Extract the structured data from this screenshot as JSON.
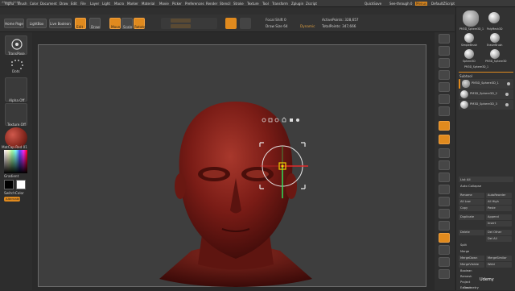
{
  "app": {
    "title": "ZBrush 2018",
    "menus": [
      "Alpha",
      "Brush",
      "Color",
      "Document",
      "Draw",
      "Edit",
      "File",
      "Layer",
      "Light",
      "Macro",
      "Marker",
      "Material",
      "Movie",
      "Picker",
      "Preferences",
      "Render",
      "Stencil",
      "Stroke",
      "Texture",
      "Tool",
      "Transform",
      "Zplugin",
      "Zscript"
    ],
    "right_menus": [
      "QuickSave",
      "See-through 0",
      "Menus",
      "DefaultZScript"
    ]
  },
  "toolbar": {
    "home_page": "Home Page",
    "lightbox": "LightBox",
    "live_boolean": "Live Boolean",
    "edit": "Edit",
    "draw": "Draw",
    "move": "Move",
    "scale": "Scale",
    "rotate": "Rotate",
    "focal_shift": "Focal Shift 0",
    "draw_size": "Draw Size 64",
    "dynamic": "Dynamic",
    "active_points": "ActivePoints: 328,657",
    "total_points": "TotalPoints: 347,666"
  },
  "left_panel": {
    "brush_label": "TransPose",
    "dots_label": "Dots",
    "alpha_label": "Alpha Off",
    "texture_label": "Texture Off",
    "material_label": "MatCap Red 01",
    "gradient_label": "Gradient",
    "switch_color": "SwitchColor",
    "alternate": "Alternate"
  },
  "right_panel": {
    "tools": [
      "PM3D_Sphere3D_1",
      "PolyMesh3D",
      "SimpleBrush",
      "EraserBrush",
      "Sphere3D",
      "PM3D_Sphere3D",
      "PM3D_Sphere3D_1"
    ],
    "subtool_header": "Subtool",
    "subtools": [
      "PM3D_Sphere3D_1",
      "PM3D_Sphere3D_2",
      "PM3D_Sphere3D_3"
    ],
    "list_all": "List All",
    "auto_collapse": "Auto Collapse",
    "buttons": [
      "Rename",
      "AutoReorder",
      "All Low",
      "All High",
      "Copy",
      "Paste",
      "Duplicate",
      "Append",
      "Insert",
      "Delete",
      "Del Other",
      "Del All",
      "Split",
      "Merge",
      "MergeDown",
      "MergeSimilar",
      "MergeVisible",
      "Weld",
      "Boolean",
      "Remesh",
      "Project",
      "Extract"
    ],
    "geometry": "Geometry",
    "ruler_icon": "ruler-icon"
  },
  "right_strip": {
    "icons": [
      "bpr-icon",
      "scroll-icon",
      "zoom-icon",
      "actual-icon",
      "aahalf-icon",
      "dynamic-icon",
      "persp-icon",
      "floor-icon",
      "local-icon",
      "xyz-icon",
      "frame-icon",
      "move-icon",
      "scale-icon",
      "rotate-icon",
      "linefill-icon",
      "polyf-icon",
      "transp-icon",
      "ghost-icon",
      "solo-icon",
      "xpose-icon"
    ]
  },
  "gizmo": {
    "icons": [
      "gear-icon",
      "lock-icon",
      "reset-icon",
      "home-icon",
      "mask-icon",
      "pin-icon"
    ]
  },
  "colors": {
    "accent": "#e08a1e",
    "head": "#7a1c16",
    "viewport_bg": "#3e3e3e"
  },
  "udemy": "Udemy"
}
